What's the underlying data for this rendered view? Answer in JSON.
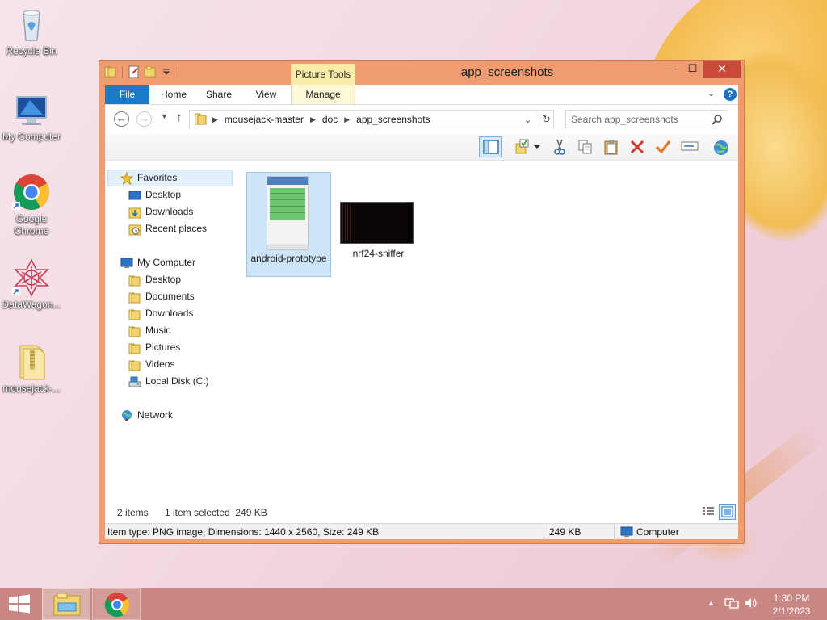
{
  "desktop": {
    "icons": [
      {
        "label": "Recycle Bin",
        "icon": "recycle-bin-icon"
      },
      {
        "label": "My Computer",
        "icon": "computer-icon"
      },
      {
        "label": "Google Chrome",
        "icon": "chrome-icon"
      },
      {
        "label": "DataWagon...",
        "icon": "datawagon-icon"
      },
      {
        "label": "mousejack-...",
        "icon": "folder-zip-icon"
      }
    ]
  },
  "window": {
    "title": "app_screenshots",
    "contextual_tab_group": "Picture Tools",
    "ribbon_tabs": {
      "file": "File",
      "home": "Home",
      "share": "Share",
      "view": "View",
      "manage": "Manage"
    },
    "controls": {
      "minimize": "—",
      "maximize": "☐",
      "close": "✕"
    },
    "help": "?"
  },
  "address": {
    "breadcrumbs": [
      "mousejack-master",
      "doc",
      "app_screenshots"
    ],
    "search_placeholder": "Search app_screenshots"
  },
  "toolbar": {
    "icons": [
      "preview-pane-icon",
      "select-all-icon",
      "cut-icon",
      "copy-icon",
      "paste-icon",
      "delete-icon",
      "properties-icon",
      "rename-icon",
      "globe-icon"
    ]
  },
  "nav": {
    "favorites": "Favorites",
    "fav_items": [
      "Desktop",
      "Downloads",
      "Recent places"
    ],
    "computer": "My Computer",
    "computer_items": [
      "Desktop",
      "Documents",
      "Downloads",
      "Music",
      "Pictures",
      "Videos",
      "Local Disk (C:)"
    ],
    "network": "Network"
  },
  "files": [
    {
      "name": "android-prototype",
      "selected": true
    },
    {
      "name": "nrf24-sniffer",
      "selected": false
    }
  ],
  "status": {
    "count": "2 items",
    "selected": "1 item selected  249 KB"
  },
  "details_bar": {
    "item_info": "Item type: PNG image, Dimensions: 1440 x 2560, Size: 249 KB",
    "size": "249 KB",
    "location": "Computer"
  },
  "taskbar": {
    "time": "1:30 PM",
    "date": "2/1/2023"
  },
  "colors": {
    "title_bar": "#f19b72",
    "close_button": "#c74a3a",
    "file_tab": "#1979ca",
    "picture_tools": "#f9eca6",
    "taskbar": "#c88783",
    "selection": "#cce4f7"
  }
}
